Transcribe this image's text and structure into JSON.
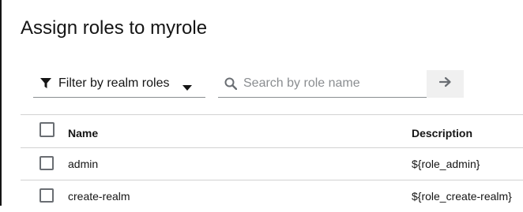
{
  "page": {
    "title": "Assign roles to myrole"
  },
  "filter": {
    "label": "Filter by realm roles",
    "icon": "filter-icon",
    "caret_icon": "caret-down-icon"
  },
  "search": {
    "placeholder": "Search by role name",
    "value": "",
    "icon": "search-icon",
    "submit_icon": "arrow-right-icon"
  },
  "table": {
    "headers": {
      "name": "Name",
      "description": "Description"
    },
    "rows": [
      {
        "name": "admin",
        "description": "${role_admin}"
      },
      {
        "name": "create-realm",
        "description": "${role_create-realm}"
      }
    ]
  },
  "colors": {
    "text": "#151515",
    "border": "#d2d2d2",
    "input_border": "#8a8d90",
    "button_bg": "#f0f0f0"
  }
}
